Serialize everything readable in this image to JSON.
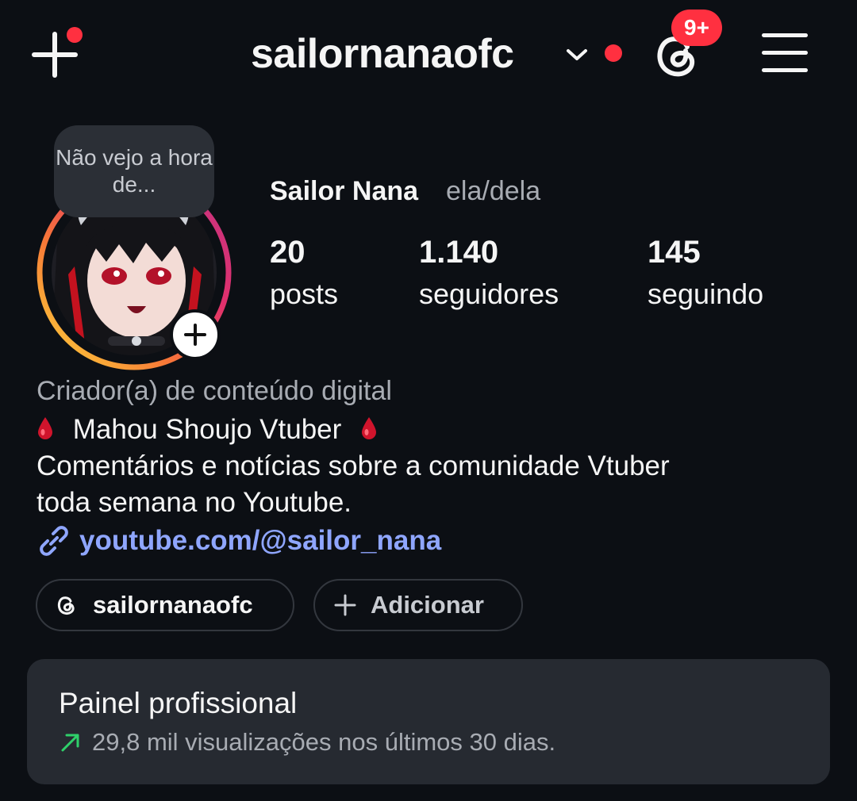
{
  "header": {
    "username": "sailornanaofc",
    "notification_badge": "9+",
    "accent_color": "#ff3040"
  },
  "profile": {
    "story_note": "Não vejo a hora de...",
    "display_name": "Sailor Nana",
    "pronouns": "ela/dela",
    "stats": [
      {
        "value": "20",
        "label": "posts"
      },
      {
        "value": "1.140",
        "label": "seguidores"
      },
      {
        "value": "145",
        "label": "seguindo"
      }
    ]
  },
  "bio": {
    "category": "Criador(a) de conteúdo digital",
    "line1": "Mahou Shoujo Vtuber",
    "line2": "Comentários e notícias sobre a comunidade Vtuber",
    "line3": "toda semana no Youtube.",
    "link": "youtube.com/@sailor_nana",
    "link_color": "#8fa6ff"
  },
  "chips": {
    "threads_label": "sailornanaofc",
    "add_label": "Adicionar"
  },
  "dashboard": {
    "title": "Painel profissional",
    "subtitle": "29,8 mil visualizações nos últimos 30 dias.",
    "trend_color": "#2fd06a"
  },
  "icons": [
    "plus-icon",
    "chevron-down-icon",
    "threads-icon",
    "menu-icon",
    "link-icon",
    "blood-drop-icon",
    "trend-up-icon"
  ]
}
